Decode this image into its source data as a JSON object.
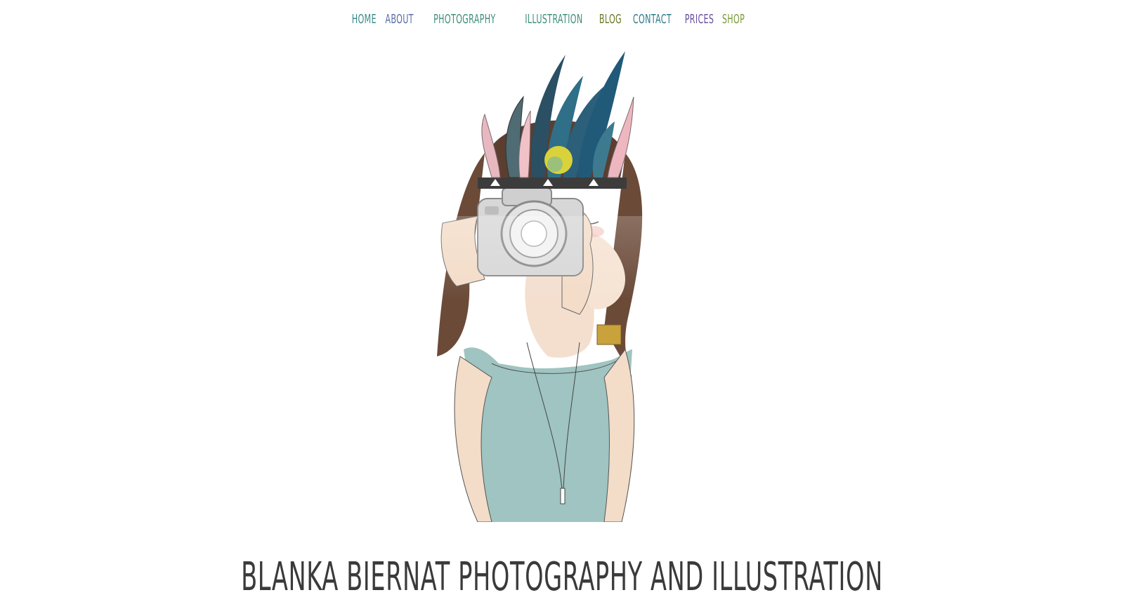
{
  "nav": {
    "items": [
      {
        "label": "HOME",
        "color": "#3b8a8a"
      },
      {
        "label": "ABOUT",
        "color": "#5a6ea8"
      },
      {
        "label": "PHOTOGRAPHY",
        "color": "#3f8f7a"
      },
      {
        "label": "ILLUSTRATION",
        "color": "#3f8f7a"
      },
      {
        "label": "BLOG",
        "color": "#6a7a2a"
      },
      {
        "label": "CONTACT",
        "color": "#2e7b8a"
      },
      {
        "label": "PRICES",
        "color": "#6a4fa0"
      },
      {
        "label": "SHOP",
        "color": "#7a9a3a"
      }
    ]
  },
  "hero": {
    "icon": "camera-girl-illustration"
  },
  "site": {
    "title": "BLANKA BIERNAT PHOTOGRAPHY AND ILLUSTRATION",
    "title_color": "#3a3a3a"
  }
}
